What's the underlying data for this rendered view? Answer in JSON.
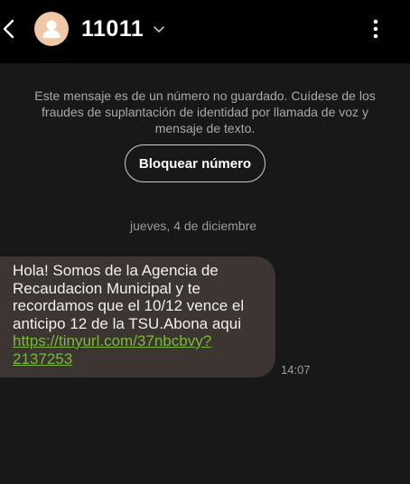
{
  "header": {
    "contact_name": "11011",
    "back_icon": "chevron-left-icon",
    "avatar_icon": "person-avatar",
    "expand_icon": "chevron-down-icon",
    "menu_icon": "more-vertical-icon"
  },
  "warning": {
    "text": "Este mensaje es de un número no guardado. Cuídese de los fraudes de suplantación de identidad por llamada de voz y mensaje de texto.",
    "block_button_label": "Bloquear número"
  },
  "conversation": {
    "date_label": "jueves, 4 de diciembre",
    "messages": [
      {
        "text": "Hola! Somos de la Agencia de Recaudacion Municipal y te recordamos que el 10/12 vence el anticipo 12 de la TSU.Abona aqui ",
        "link": "https://tinyurl.com/37nbcbvy?2137253",
        "time": "14:07"
      }
    ]
  },
  "colors": {
    "background": "#181818",
    "header_background": "#000000",
    "bubble_background": "#3c3532",
    "link": "#7ab83b",
    "muted_text": "#a9a9a9",
    "avatar": "#f0c8a8"
  }
}
